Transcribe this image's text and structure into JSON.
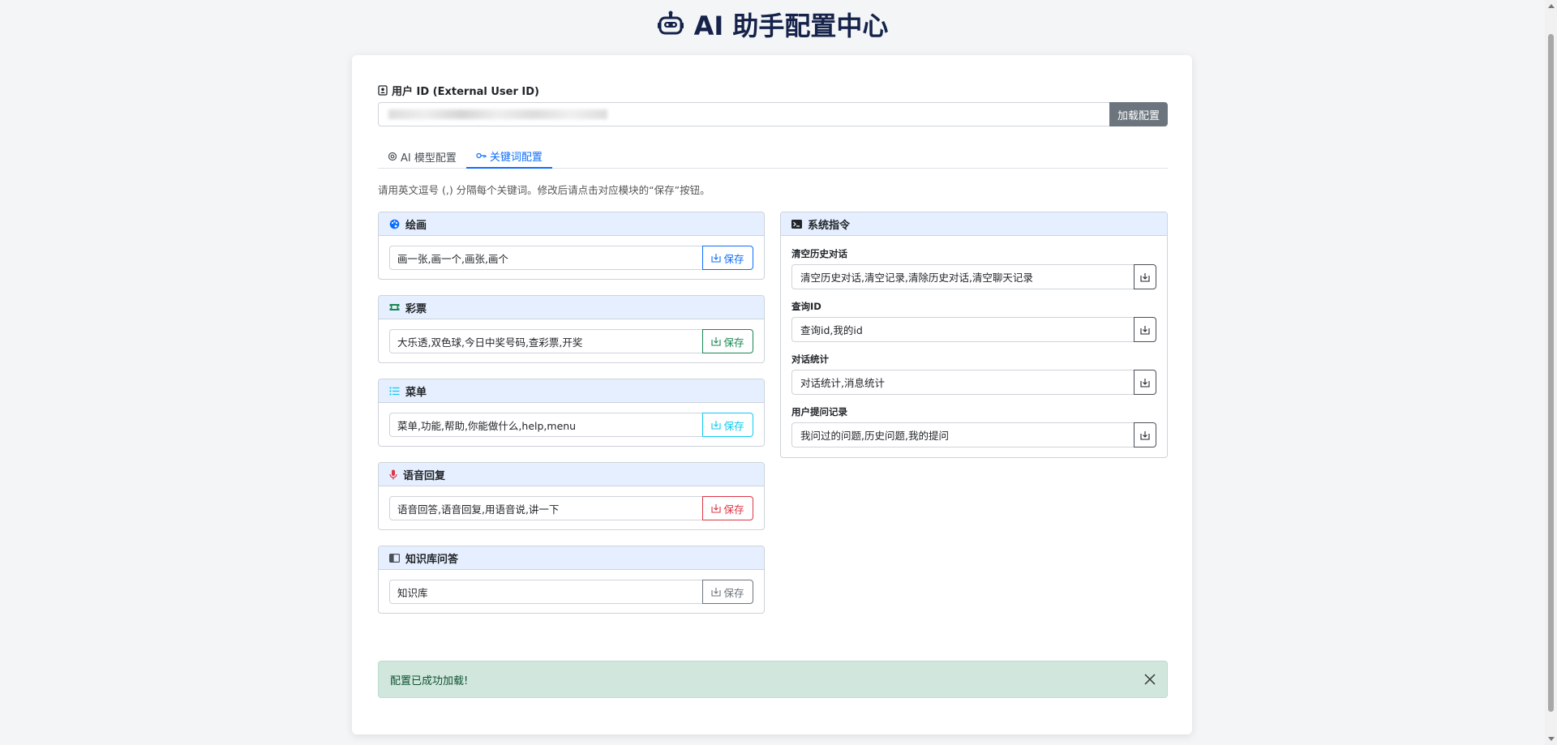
{
  "header": {
    "title": "AI 助手配置中心",
    "icon": "robot-icon"
  },
  "user_id": {
    "label": "用户 ID (External User ID)",
    "load_button": "加载配置"
  },
  "tabs": [
    {
      "label": "AI 模型配置",
      "icon": "cpu-icon",
      "active": false
    },
    {
      "label": "关键词配置",
      "icon": "key-icon",
      "active": true
    }
  ],
  "hint": "请用英文逗号 (,) 分隔每个关键词。修改后请点击对应模块的“保存”按钮。",
  "left_panels": [
    {
      "title": "绘画",
      "icon": "palette-icon",
      "value": "画一张,画一个,画张,画个",
      "save": "保存",
      "color": "#0d6efd"
    },
    {
      "title": "彩票",
      "icon": "ticket-icon",
      "value": "大乐透,双色球,今日中奖号码,查彩票,开奖",
      "save": "保存",
      "color": "#198754"
    },
    {
      "title": "菜单",
      "icon": "list-icon",
      "value": "菜单,功能,帮助,你能做什么,help,menu",
      "save": "保存",
      "color": "#0dcaf0"
    },
    {
      "title": "语音回复",
      "icon": "mic-icon",
      "value": "语音回答,语音回复,用语音说,讲一下",
      "save": "保存",
      "color": "#dc3545"
    },
    {
      "title": "知识库问答",
      "icon": "book-icon",
      "value": "知识库",
      "save": "保存",
      "color": "#6c757d"
    }
  ],
  "system_panel": {
    "title": "系统指令",
    "icon": "terminal-icon",
    "items": [
      {
        "label": "清空历史对话",
        "value": "清空历史对话,清空记录,清除历史对话,清空聊天记录"
      },
      {
        "label": "查询ID",
        "value": "查询id,我的id"
      },
      {
        "label": "对话统计",
        "value": "对话统计,消息统计"
      },
      {
        "label": "用户提问记录",
        "value": "我问过的问题,历史问题,我的提问"
      }
    ]
  },
  "alert": {
    "message": "配置已成功加载!"
  },
  "colors": {
    "accent": "#0d6efd",
    "title": "#15224a",
    "panel_header": "#e6efff",
    "alert_bg": "#d1e7dd"
  }
}
